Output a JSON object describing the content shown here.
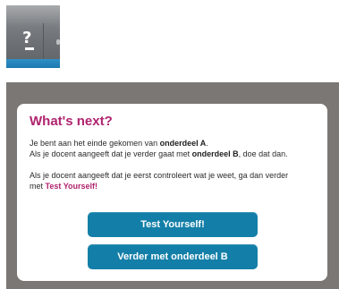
{
  "toolbar": {
    "help_label": "?"
  },
  "dialog": {
    "title": "What's next?",
    "line1_prefix": "Je bent aan het einde gekomen van ",
    "line1_bold": "onderdeel A",
    "line1_suffix": ".",
    "line2_prefix": "Als je docent aangeeft dat je verder gaat met ",
    "line2_bold": "onderdeel B",
    "line2_suffix": ", doe dat dan.",
    "line3": "Als je docent aangeeft dat je eerst controleert wat je weet, ga dan verder",
    "line4_prefix": "met ",
    "line4_magenta": "Test Yourself!",
    "buttons": {
      "test_label": "Test Yourself!",
      "verder_label": "Verder met onderdeel B"
    }
  },
  "colors": {
    "accent_magenta": "#b0236e",
    "button_blue": "#137fa8",
    "overlay_gray": "#7a7774"
  },
  "icons": {
    "help": "question-mark-icon"
  }
}
